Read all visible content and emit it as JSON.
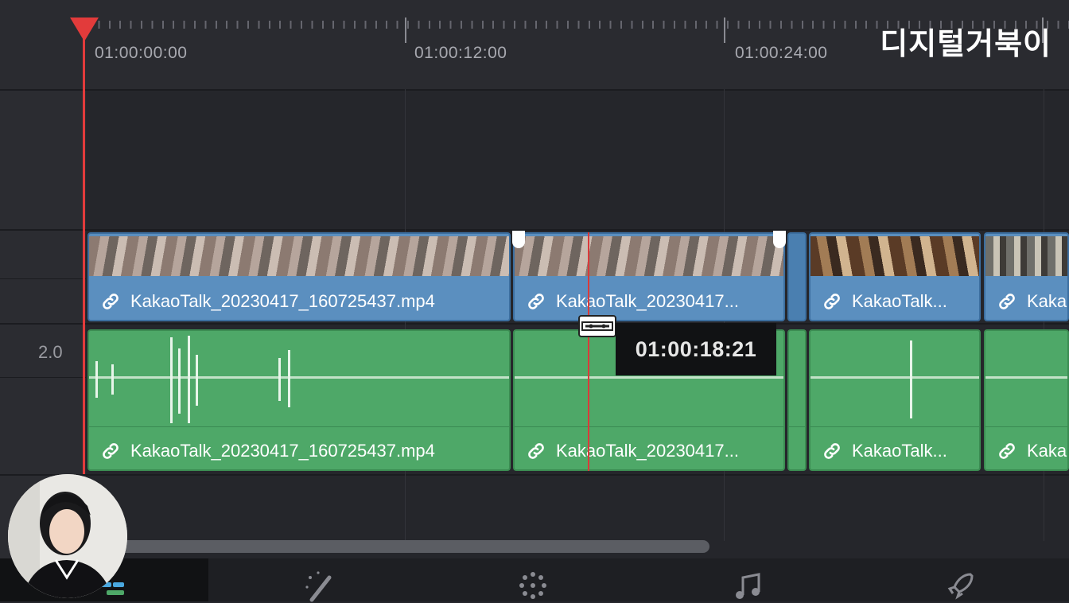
{
  "watermark": "디지털거북이",
  "ruler": {
    "timecodes": [
      "01:00:00:00",
      "01:00:12:00",
      "01:00:24:00"
    ]
  },
  "tracks": {
    "audio_level": "2.0"
  },
  "video_clips": [
    {
      "label": "KakaoTalk_20230417_160725437.mp4"
    },
    {
      "label": "KakaoTalk_20230417..."
    },
    {
      "label": "KakaoTalk..."
    },
    {
      "label": "Kaka"
    }
  ],
  "audio_clips": [
    {
      "label": "KakaoTalk_20230417_160725437.mp4"
    },
    {
      "label": "KakaoTalk_20230417..."
    },
    {
      "label": "KakaoTalk..."
    },
    {
      "label": "Kaka"
    }
  ],
  "tooltip": {
    "timecode": "01:00:18:21"
  },
  "icons": {
    "link": "link-icon",
    "razor": "razor-blade-icon",
    "fx": "magic-wand-icon",
    "color": "color-wheel-icon",
    "fairlight": "music-note-icon",
    "deliver": "rocket-icon",
    "edit": "timeline-edit-icon"
  },
  "colors": {
    "video_clip": "#5b8fbf",
    "audio_clip": "#4ea868",
    "playhead": "#e23b3b"
  }
}
